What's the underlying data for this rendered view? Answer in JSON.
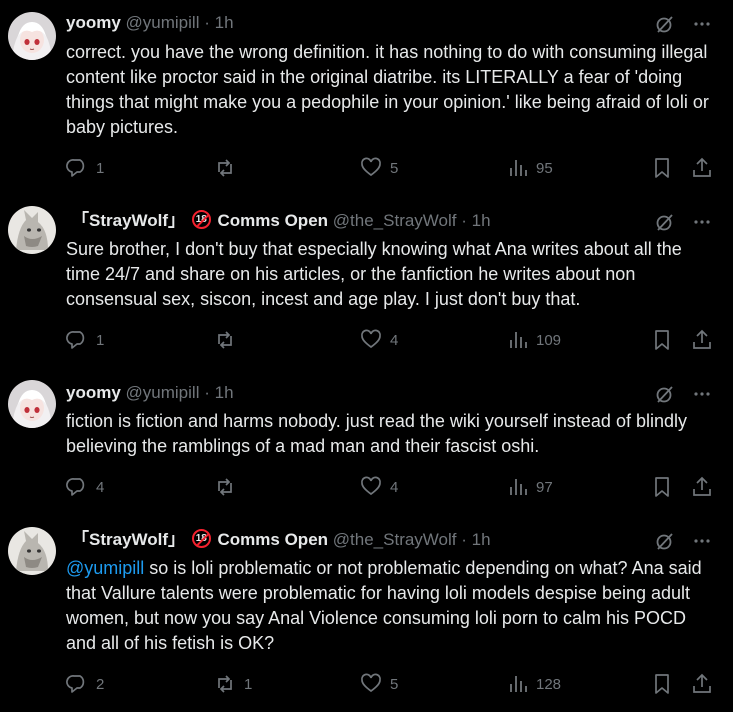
{
  "tweets": [
    {
      "name": "yoomy",
      "handle": "@yumipill",
      "time": "1h",
      "text": "correct. you have the wrong definition. it has nothing to do with consuming illegal content like proctor said in the original diatribe. its LITERALLY a fear of 'doing things that might make you a pedophile in your opinion.' like being afraid of loli or baby pictures.",
      "replies": "1",
      "reposts": "",
      "likes": "5",
      "views": "95"
    },
    {
      "name_open": "「",
      "name_main": "StrayWolf",
      "name_close": "」",
      "name_after": "Comms Open",
      "badge": "18",
      "handle": "@the_StrayWolf",
      "time": "1h",
      "text": "Sure brother, I don't buy that especially knowing what Ana writes about all the time 24/7 and share on his articles, or the fanfiction he writes about non consensual sex, siscon, incest and age play. I just don't buy that.",
      "replies": "1",
      "reposts": "",
      "likes": "4",
      "views": "109"
    },
    {
      "name": "yoomy",
      "handle": "@yumipill",
      "time": "1h",
      "text": "fiction is fiction and harms nobody. just read the wiki yourself instead of blindly believing the ramblings of a mad man and their fascist oshi.",
      "replies": "4",
      "reposts": "",
      "likes": "4",
      "views": "97"
    },
    {
      "name_open": "「",
      "name_main": "StrayWolf",
      "name_close": "」",
      "name_after": "Comms Open",
      "badge": "18",
      "handle": "@the_StrayWolf",
      "time": "1h",
      "mention": "@yumipill",
      "text": " so is loli problematic or not problematic depending on what? Ana said that Vallure talents were problematic for having loli models despise being adult women, but now you say Anal Violence consuming loli porn to calm his POCD and all of his fetish is OK?",
      "replies": "2",
      "reposts": "1",
      "likes": "5",
      "views": "128"
    }
  ],
  "separator": "·",
  "colors": {
    "background": "#000000",
    "text": "#e7e9ea",
    "muted": "#71767b",
    "link": "#1d9bf0",
    "badge": "#f4212e"
  },
  "icons": [
    "grok-icon",
    "more-icon",
    "reply-icon",
    "repost-icon",
    "like-icon",
    "views-icon",
    "bookmark-icon",
    "share-icon"
  ]
}
